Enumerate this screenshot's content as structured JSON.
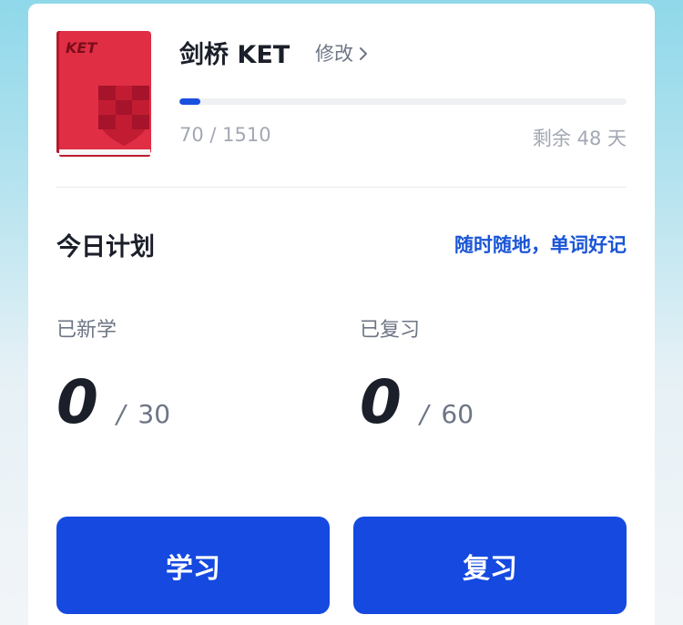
{
  "book": {
    "cover_label": "KET",
    "title": "剑桥 KET",
    "edit_label": "修改",
    "progress_current": 70,
    "progress_total": 1510,
    "progress_text": "70 / 1510",
    "remaining_text": "剩余 48 天"
  },
  "plan": {
    "title": "今日计划",
    "slogan": "随时随地，单词好记",
    "new": {
      "label": "已新学",
      "value": "0",
      "slash": "/",
      "total": "30"
    },
    "review": {
      "label": "已复习",
      "value": "0",
      "slash": "/",
      "total": "60"
    }
  },
  "buttons": {
    "study": "学习",
    "review": "复习"
  },
  "colors": {
    "accent": "#1549e0",
    "book_red": "#e02e45",
    "slogan_blue": "#1a55d6"
  }
}
